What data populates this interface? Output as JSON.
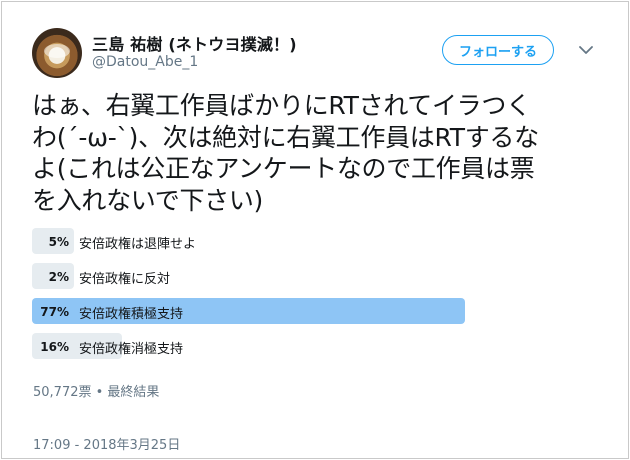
{
  "user": {
    "display_name": "三島 祐樹 (ネトウヨ撲滅！)",
    "screen_name": "@Datou_Abe_1",
    "follow_label": "フォローする",
    "caret_icon": "chevron-down-icon"
  },
  "tweet": {
    "lines": [
      "はぁ、右翼工作員ばかりにRTされてイラつく",
      "わ(´-ω-`)、次は絶対に右翼工作員はRTするな",
      "よ(これは公正なアンケートなので工作員は票",
      "を入れないで下さい)"
    ]
  },
  "poll": {
    "options": [
      {
        "percent": "5%",
        "value": 5,
        "label": "安倍政権は退陣せよ",
        "winner": false
      },
      {
        "percent": "2%",
        "value": 2,
        "label": "安倍政権に反対",
        "winner": false
      },
      {
        "percent": "77%",
        "value": 77,
        "label": "安倍政権積極支持",
        "winner": true
      },
      {
        "percent": "16%",
        "value": 16,
        "label": "安倍政権消極支持",
        "winner": false
      }
    ],
    "meta": "50,772票 • 最終結果"
  },
  "timestamp": "17:09 - 2018年3月25日",
  "colors": {
    "accent": "#1da1f2",
    "winner_bar": "#8ec5f5",
    "bar": "#e6ecf0",
    "secondary_text": "#657786"
  }
}
